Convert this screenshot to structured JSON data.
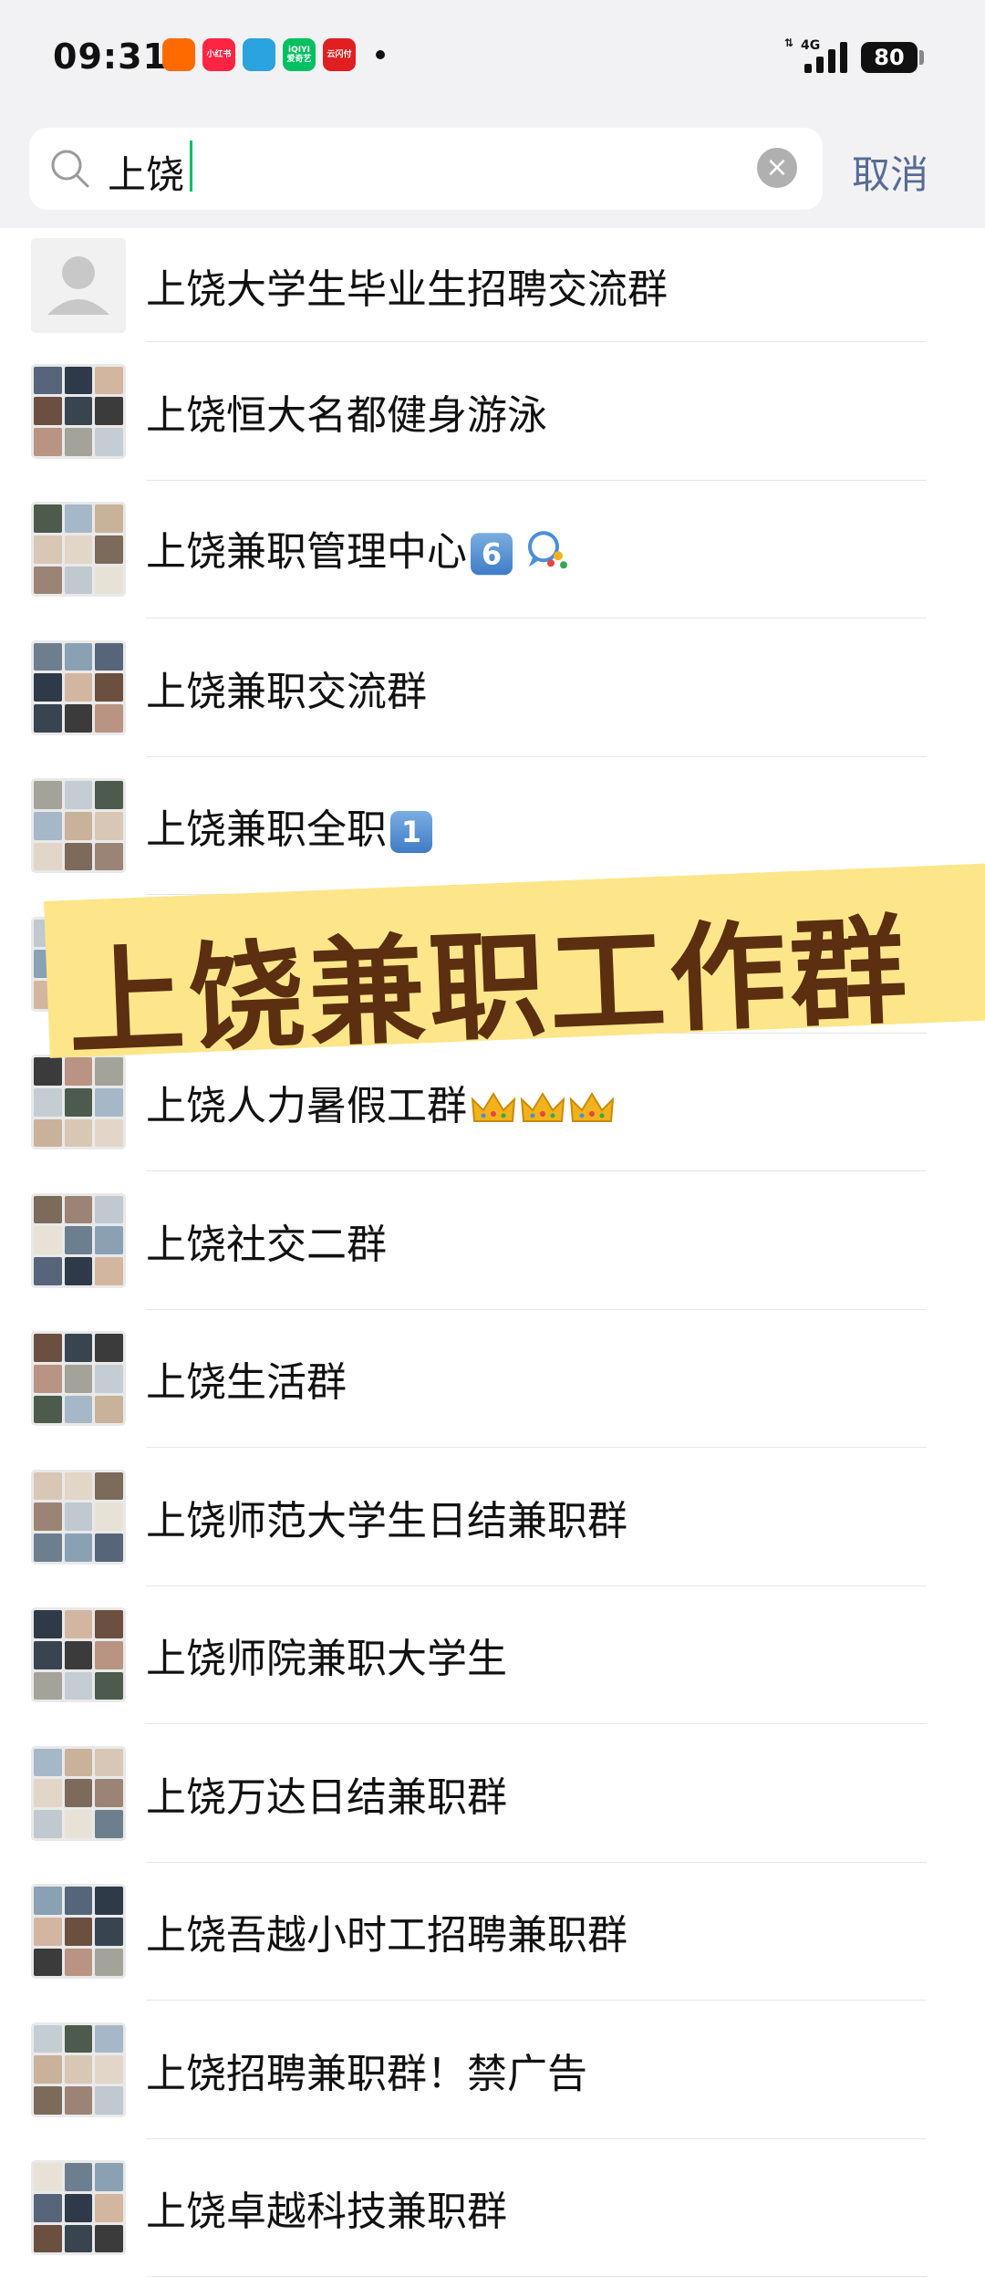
{
  "status_bar": {
    "time": "09:31",
    "network": "4G",
    "battery": "80",
    "apps": [
      {
        "name": "taobao-app-icon",
        "label": "",
        "color": "#ff6a00"
      },
      {
        "name": "xiaohongshu-app-icon",
        "label": "小红书",
        "color": "#ff2442"
      },
      {
        "name": "telegram-app-icon",
        "label": "",
        "color": "#2aa3df"
      },
      {
        "name": "iqiyi-app-icon",
        "label": "iQIYI 爱奇艺",
        "color": "#00c060"
      },
      {
        "name": "yunshanfu-app-icon",
        "label": "云闪付",
        "color": "#e02020"
      }
    ]
  },
  "search": {
    "query": "上饶",
    "cancel_label": "取消"
  },
  "results": [
    {
      "title": "上饶大学生毕业生招聘交流群",
      "avatar": "single"
    },
    {
      "title": "上饶恒大名都健身游泳",
      "avatar": "grid"
    },
    {
      "title": "上饶兼职管理中心",
      "badge": "6",
      "chat_icon": true,
      "avatar": "grid"
    },
    {
      "title": "上饶兼职交流群",
      "avatar": "grid"
    },
    {
      "title": "上饶兼职全职",
      "badge": "1",
      "avatar": "grid"
    },
    {
      "title": "",
      "avatar": "grid"
    },
    {
      "title": "上饶人力暑假工群",
      "crowns": 3,
      "avatar": "grid"
    },
    {
      "title": "上饶社交二群",
      "avatar": "grid"
    },
    {
      "title": "上饶生活群",
      "avatar": "grid"
    },
    {
      "title": "上饶师范大学生日结兼职群",
      "avatar": "grid"
    },
    {
      "title": "上饶师院兼职大学生",
      "avatar": "grid"
    },
    {
      "title": "上饶万达日结兼职群",
      "avatar": "grid"
    },
    {
      "title": "上饶吾越小时工招聘兼职群",
      "avatar": "grid"
    },
    {
      "title": "上饶招聘兼职群！禁广告",
      "avatar": "grid"
    },
    {
      "title": "上饶卓越科技兼职群",
      "avatar": "grid"
    }
  ],
  "banner": {
    "text": "上饶兼职工作群",
    "bg_color": "#fde68a",
    "text_color": "#5b2f0f"
  },
  "colors": {
    "accent_green": "#07c160",
    "cancel_blue": "#576b95"
  }
}
